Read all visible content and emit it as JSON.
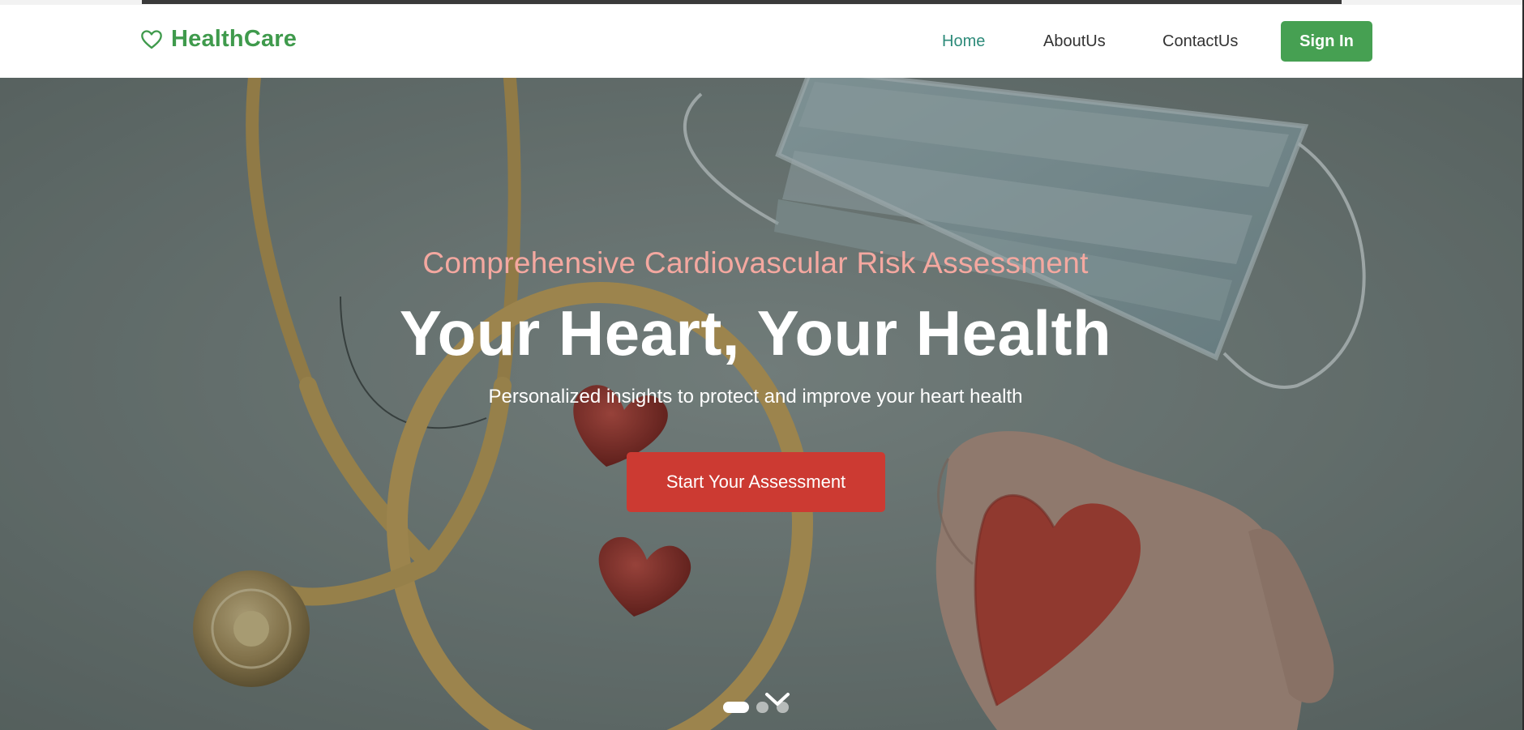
{
  "brand": {
    "name": "HealthCare",
    "icon": "heart-outline-icon",
    "color": "#3f9a4c"
  },
  "nav": {
    "links": [
      {
        "label": "Home",
        "active": true
      },
      {
        "label": "AboutUs",
        "active": false
      },
      {
        "label": "ContactUs",
        "active": false
      }
    ],
    "signin_label": "Sign In"
  },
  "hero": {
    "tagline": "Comprehensive Cardiovascular Risk Assessment",
    "title": "Your Heart, Your Health",
    "subtitle": "Personalized insights to protect and improve your heart health",
    "cta_label": "Start Your Assessment"
  },
  "carousel": {
    "slide_count": 3,
    "active_index": 0,
    "scroll_icon": "chevron-down-icon"
  },
  "colors": {
    "accent_green": "#46a052",
    "active_link": "#2e8b7a",
    "cta_red": "#cc3a32",
    "tagline_pink": "#f4a8a0"
  }
}
